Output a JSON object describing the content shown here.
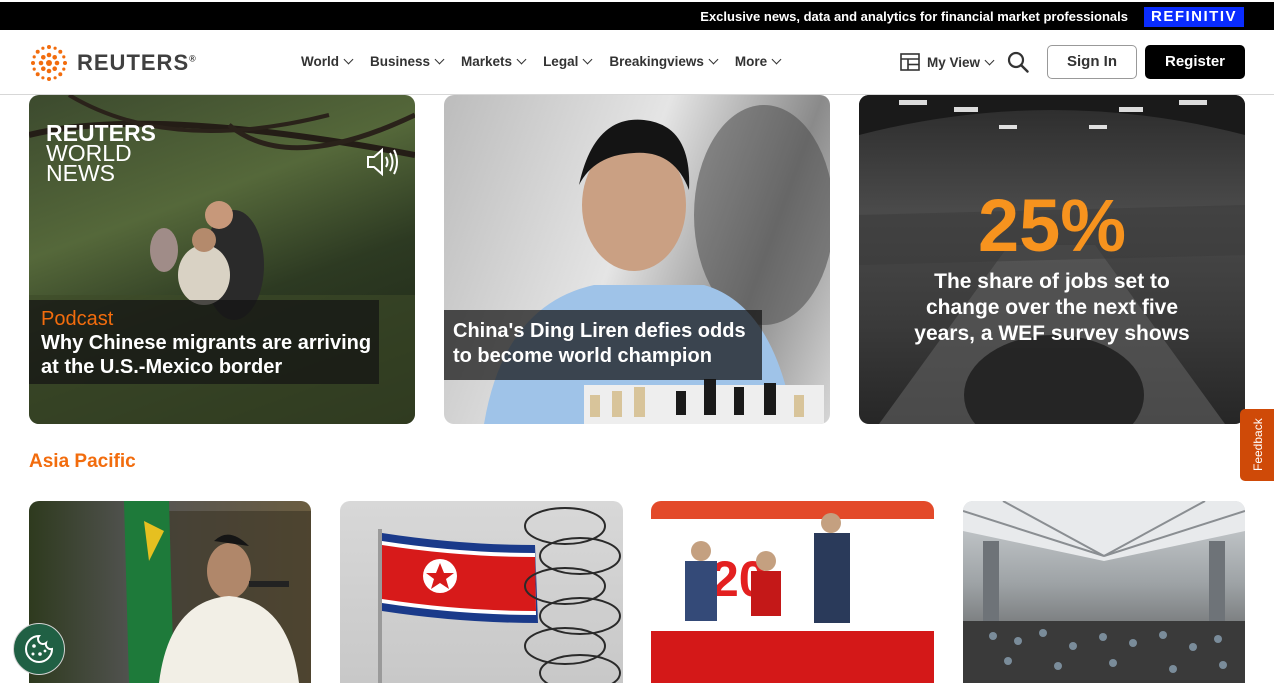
{
  "topbar": {
    "promo": "Exclusive news, data and analytics for financial market professionals",
    "brand": "REFINITIV"
  },
  "logo": {
    "wordmark": "REUTERS",
    "mark": "®"
  },
  "nav": [
    {
      "label": "World"
    },
    {
      "label": "Business"
    },
    {
      "label": "Markets"
    },
    {
      "label": "Legal"
    },
    {
      "label": "Breakingviews"
    },
    {
      "label": "More"
    }
  ],
  "actions": {
    "my_view": "My View",
    "sign_in": "Sign In",
    "register": "Register"
  },
  "cards": [
    {
      "brand_line1": "REUTERS",
      "brand_line2": "WORLD",
      "brand_line3": "NEWS",
      "kicker": "Podcast",
      "title": "Why Chinese migrants are arriving at the U.S.-Mexico border"
    },
    {
      "title": "China's Ding Liren defies odds to become world champion"
    },
    {
      "stat": "25%",
      "title": "The share of jobs set to change over the next five years, a WEF survey shows"
    }
  ],
  "section": {
    "title": "Asia Pacific"
  },
  "feedback": "Feedback",
  "colors": {
    "accent": "#f26c0d",
    "brand_blue": "#0a2cff",
    "feedback": "#cf4a08"
  }
}
